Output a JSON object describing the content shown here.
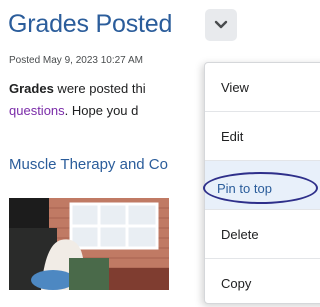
{
  "post": {
    "title": "Grades Posted",
    "posted": "Posted May 9, 2023 10:27 AM",
    "body_bold": "Grades",
    "body_rest": " were posted thi",
    "link_text": "questions",
    "body_line2_rest": ". Hope you d",
    "course": "Muscle Therapy and Co"
  },
  "menu": {
    "items": [
      {
        "label": "View"
      },
      {
        "label": "Edit"
      },
      {
        "label": "Pin to top"
      },
      {
        "label": "Delete"
      },
      {
        "label": "Copy"
      }
    ]
  },
  "colors": {
    "title": "#2b5d9b",
    "link": "#7a2ba8",
    "highlight_ring": "#2e2f8a",
    "menu_hover": "#e8f0fa"
  },
  "icons": {
    "dropdown": "chevron-down-icon"
  }
}
